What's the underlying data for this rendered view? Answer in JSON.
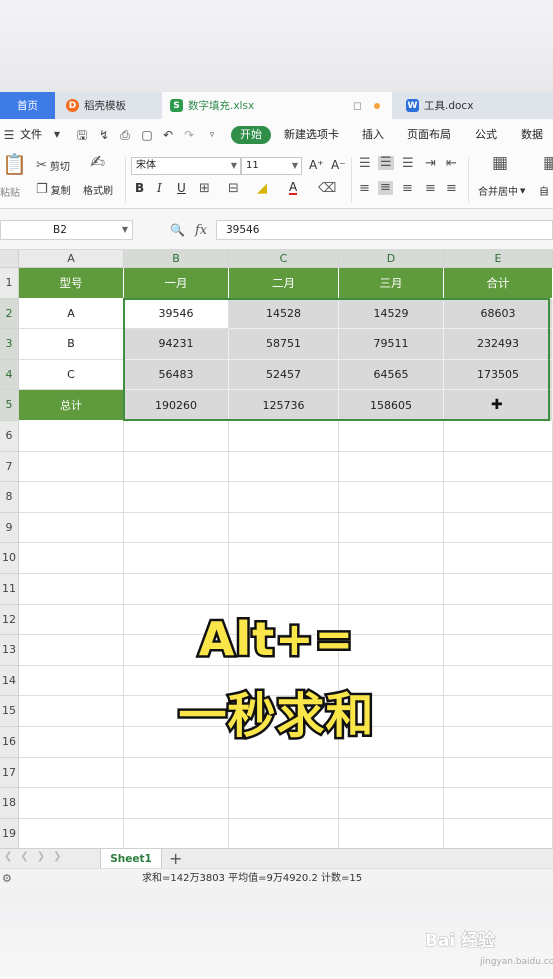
{
  "tabs": {
    "home": "首页",
    "template": "稻壳模板",
    "sheet_file": "数字填充.xlsx",
    "doc_file": "工具.docx",
    "template_icon": "D",
    "sheet_icon": "S",
    "doc_icon": "W"
  },
  "menu": {
    "file": "文件",
    "start": "开始",
    "new_tab": "新建选项卡",
    "insert": "插入",
    "layout": "页面布局",
    "formula": "公式",
    "data": "数据"
  },
  "ribbon": {
    "paste": "粘贴",
    "cut": "剪切",
    "copy": "复制",
    "format_painter": "格式刷",
    "font_name": "宋体",
    "font_size": "11",
    "bold": "B",
    "italic": "I",
    "underline": "U",
    "font_color_letter": "A",
    "merge_center": "合并居中",
    "auto_wrap": "自"
  },
  "formula_bar": {
    "cell_ref": "B2",
    "fx": "fx",
    "value": "39546"
  },
  "columns": [
    "A",
    "B",
    "C",
    "D",
    "E"
  ],
  "rows": [
    "1",
    "2",
    "3",
    "4",
    "5",
    "6",
    "7",
    "8",
    "9",
    "10",
    "11",
    "12",
    "13",
    "14",
    "15",
    "16",
    "17",
    "18",
    "19"
  ],
  "table": {
    "header": [
      "型号",
      "一月",
      "二月",
      "三月",
      "合计"
    ],
    "body": [
      [
        "A",
        "39546",
        "14528",
        "14529",
        "68603"
      ],
      [
        "B",
        "94231",
        "58751",
        "79511",
        "232493"
      ],
      [
        "C",
        "56483",
        "52457",
        "64565",
        "173505"
      ],
      [
        "总计",
        "190260",
        "125736",
        "158605",
        ""
      ]
    ]
  },
  "overlay": {
    "line1": "Alt+=",
    "line2": "一秒求和"
  },
  "sheet": {
    "name": "Sheet1",
    "add": "+"
  },
  "status": {
    "text": "求和=142万3803  平均值=9万4920.2  计数=15"
  },
  "watermark": {
    "logo": "Bai 经验",
    "sub": "jingyan.baidu.com"
  },
  "colors": {
    "accent_green": "#2f8f49",
    "table_header_green": "#5f9a3c",
    "selection_border": "#3f8f3f",
    "home_tab_blue": "#3e7be6",
    "overlay_yellow": "#fbe64a"
  }
}
